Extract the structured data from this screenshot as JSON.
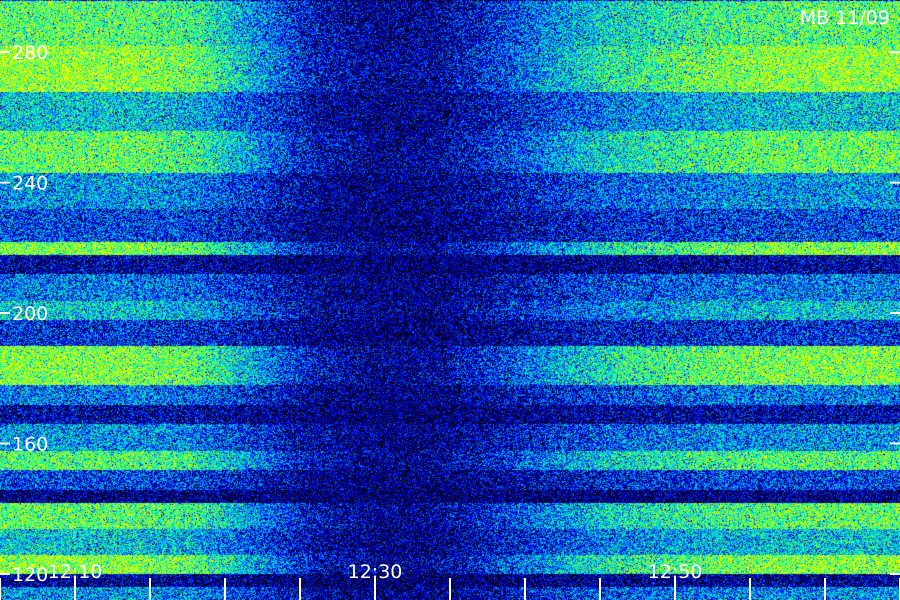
{
  "chart_data": {
    "type": "heatmap",
    "title": "MB 11/09",
    "xlabel": "",
    "ylabel": "",
    "x_ticks": [
      {
        "label": "12:10",
        "minute": 10
      },
      {
        "label": "12:30",
        "minute": 30
      },
      {
        "label": "12:50",
        "minute": 50
      }
    ],
    "x_minor_step_minutes": 5,
    "x_range_minutes": [
      5,
      65
    ],
    "y_ticks": [
      120,
      160,
      200,
      240,
      280
    ],
    "y_range": [
      112,
      296
    ],
    "colormap": [
      "#000000",
      "#00005a",
      "#0000ff",
      "#00b4ff",
      "#00ffaa",
      "#b4ff00",
      "#ffff00"
    ],
    "intensity_profile_time_minutes": [
      5,
      14,
      18,
      22,
      26,
      30,
      34,
      38,
      42,
      46,
      50,
      54,
      60,
      65
    ],
    "intensity_profile_values": [
      1.0,
      1.0,
      0.9,
      0.55,
      0.2,
      0.08,
      0.1,
      0.3,
      0.55,
      0.75,
      0.85,
      0.95,
      1.0,
      1.0
    ],
    "bands": [
      {
        "y_low": 282,
        "y_high": 296,
        "level": 0.8
      },
      {
        "y_low": 268,
        "y_high": 282,
        "level": 0.92
      },
      {
        "y_low": 256,
        "y_high": 268,
        "level": 0.55
      },
      {
        "y_low": 243,
        "y_high": 256,
        "level": 0.82
      },
      {
        "y_low": 232,
        "y_high": 243,
        "level": 0.45
      },
      {
        "y_low": 222,
        "y_high": 232,
        "level": 0.3
      },
      {
        "y_low": 218,
        "y_high": 222,
        "level": 0.88
      },
      {
        "y_low": 212,
        "y_high": 218,
        "level": 0.1
      },
      {
        "y_low": 204,
        "y_high": 212,
        "level": 0.4
      },
      {
        "y_low": 198,
        "y_high": 204,
        "level": 0.55
      },
      {
        "y_low": 190,
        "y_high": 198,
        "level": 0.25
      },
      {
        "y_low": 178,
        "y_high": 190,
        "level": 0.88
      },
      {
        "y_low": 172,
        "y_high": 178,
        "level": 0.4
      },
      {
        "y_low": 166,
        "y_high": 172,
        "level": 0.12
      },
      {
        "y_low": 158,
        "y_high": 166,
        "level": 0.45
      },
      {
        "y_low": 152,
        "y_high": 158,
        "level": 0.78
      },
      {
        "y_low": 146,
        "y_high": 152,
        "level": 0.3
      },
      {
        "y_low": 142,
        "y_high": 146,
        "level": 0.05
      },
      {
        "y_low": 134,
        "y_high": 142,
        "level": 0.8
      },
      {
        "y_low": 126,
        "y_high": 134,
        "level": 0.55
      },
      {
        "y_low": 120,
        "y_high": 126,
        "level": 0.9
      },
      {
        "y_low": 116,
        "y_high": 120,
        "level": 0.08
      },
      {
        "y_low": 112,
        "y_high": 116,
        "level": 0.45
      }
    ],
    "grid": false
  }
}
